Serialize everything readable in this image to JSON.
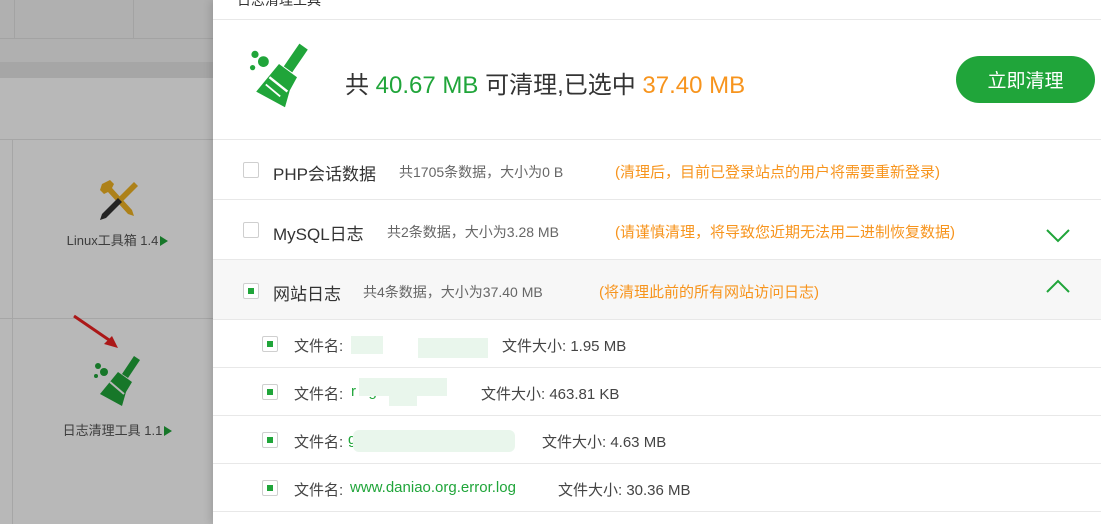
{
  "background": {
    "tools": [
      {
        "label": "Linux工具箱 1.4",
        "icon": "wrench-screwdriver-icon"
      },
      {
        "label": "日志清理工具 1.1",
        "icon": "broom-icon"
      }
    ]
  },
  "drawer": {
    "title": "日志清理工具",
    "summary": {
      "prefix": "共 ",
      "total": "40.67 MB",
      "middle": " 可清理,已选中 ",
      "selected": "37.40 MB"
    },
    "clean_button": "立即清理",
    "categories": [
      {
        "name": "PHP会话数据",
        "info": "共1705条数据，大小为0 B",
        "warning": "(清理后，目前已登录站点的用户将需要重新登录)",
        "checked": false
      },
      {
        "name": "MySQL日志",
        "info": "共2条数据，大小为3.28 MB",
        "warning": "(请谨慎清理，将导致您近期无法用二进制恢复数据)",
        "checked": false,
        "expanded": false
      },
      {
        "name": "网站日志",
        "info": "共4条数据，大小为37.40 MB",
        "warning": "(将清理此前的所有网站访问日志)",
        "checked": true,
        "expanded": true
      }
    ],
    "files": [
      {
        "label": "文件名:",
        "name": "",
        "size_label": "文件大小: 1.95 MB"
      },
      {
        "label": "文件名:",
        "name": "r               og",
        "size_label": "文件大小: 463.81 KB"
      },
      {
        "label": "文件名:",
        "name": "                    g",
        "size_label": "文件大小: 4.63 MB"
      },
      {
        "label": "文件名:",
        "name": "www.daniao.org.error.log",
        "size_label": "文件大小: 30.36 MB"
      }
    ]
  },
  "colors": {
    "accent": "#20a53a",
    "warning": "#f7941d"
  }
}
